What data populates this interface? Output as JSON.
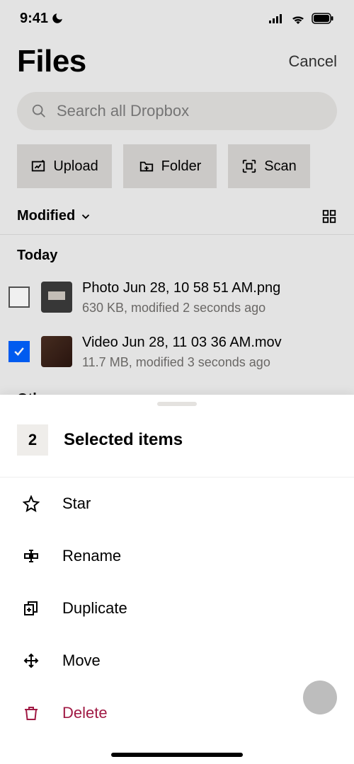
{
  "status": {
    "time": "9:41"
  },
  "header": {
    "title": "Files",
    "cancel": "Cancel"
  },
  "search": {
    "placeholder": "Search all Dropbox"
  },
  "actions": {
    "upload": "Upload",
    "folder": "Folder",
    "scan": "Scan"
  },
  "sort": {
    "label": "Modified"
  },
  "sections": {
    "today": "Today",
    "other": "Other"
  },
  "files": [
    {
      "name": "Photo Jun 28, 10 58 51 AM.png",
      "sub": "630 KB, modified 2 seconds ago",
      "checked": false
    },
    {
      "name": "Video Jun 28, 11 03 36 AM.mov",
      "sub": "11.7 MB, modified 3 seconds ago",
      "checked": true
    }
  ],
  "sheet": {
    "count": "2",
    "title": "Selected items",
    "items": {
      "star": "Star",
      "rename": "Rename",
      "duplicate": "Duplicate",
      "move": "Move",
      "delete": "Delete"
    }
  }
}
